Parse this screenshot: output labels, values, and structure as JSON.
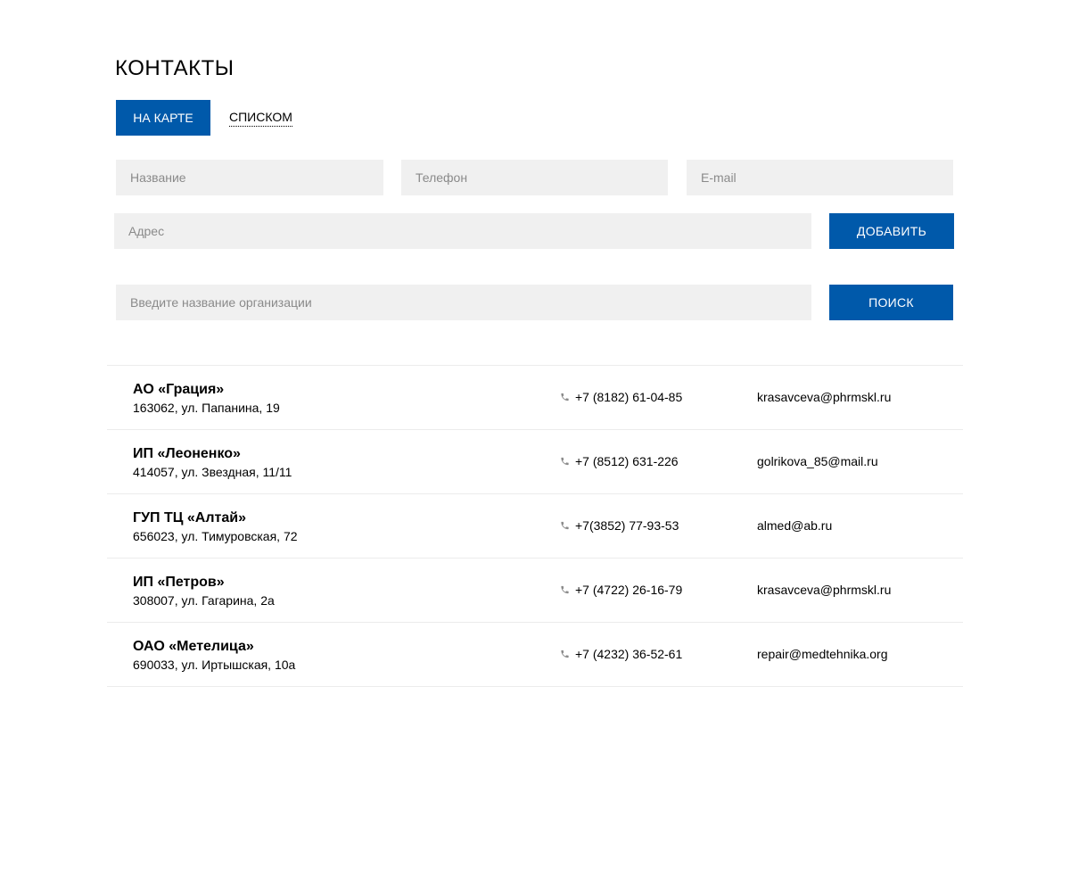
{
  "page": {
    "title": "КОНТАКТЫ"
  },
  "tabs": {
    "map_label": "НА КАРТЕ",
    "list_label": "СПИСКОМ"
  },
  "form": {
    "name_placeholder": "Название",
    "phone_placeholder": "Телефон",
    "email_placeholder": "E-mail",
    "address_placeholder": "Адрес",
    "add_label": "ДОБАВИТЬ"
  },
  "search": {
    "placeholder": "Введите название организации",
    "button_label": "ПОИСК"
  },
  "colors": {
    "accent": "#0059aa",
    "field_bg": "#f0f0f0",
    "divider": "#ececec"
  },
  "icons": {
    "phone": "phone-icon"
  },
  "organizations": [
    {
      "name": "АО «Грация»",
      "address": "163062, ул. Папанина, 19",
      "phone": "+7 (8182) 61-04-85",
      "email": "krasavceva@phrmskl.ru"
    },
    {
      "name": "ИП «Леоненко»",
      "address": "414057, ул. Звездная, 11/11",
      "phone": "+7 (8512) 631-226",
      "email": "golrikova_85@mail.ru"
    },
    {
      "name": "ГУП ТЦ «Алтай»",
      "address": "656023, ул. Тимуровская, 72",
      "phone": "+7(3852) 77-93-53",
      "email": "almed@ab.ru"
    },
    {
      "name": "ИП «Петров»",
      "address": "308007, ул. Гагарина, 2а",
      "phone": "+7 (4722) 26-16-79",
      "email": "krasavceva@phrmskl.ru"
    },
    {
      "name": "ОАО «Метелица»",
      "address": "690033, ул. Иртышская, 10а",
      "phone": "+7 (4232) 36-52-61",
      "email": "repair@medtehnika.org"
    }
  ]
}
